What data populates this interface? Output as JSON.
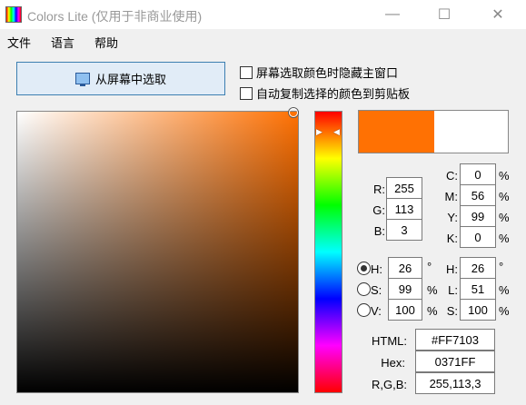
{
  "window": {
    "title": "Colors Lite (仅用于非商业使用)",
    "minimize": "—",
    "maximize": "☐",
    "close": "✕"
  },
  "menu": [
    "文件",
    "语言",
    "帮助"
  ],
  "pick_button": "从屏幕中选取",
  "options": {
    "hide_main": "屏幕选取颜色时隐藏主窗口",
    "auto_copy": "自动复制选择的颜色到剪贴板"
  },
  "colors": {
    "current": "#FF7103",
    "previous": "#FFFFFF"
  },
  "rgb": {
    "r_label": "R:",
    "r": "255",
    "g_label": "G:",
    "g": "113",
    "b_label": "B:",
    "b": "3"
  },
  "cmyk": {
    "c_label": "C:",
    "c": "0",
    "m_label": "M:",
    "m": "56",
    "y_label": "Y:",
    "y": "99",
    "k_label": "K:",
    "k": "0",
    "unit": "%"
  },
  "hsv": {
    "h_label": "H:",
    "h": "26",
    "h_unit": "°",
    "s_label": "S:",
    "s": "99",
    "s_unit": "%",
    "v_label": "V:",
    "v": "100",
    "v_unit": "%",
    "selected": "H"
  },
  "hsl": {
    "h_label": "H:",
    "h": "26",
    "h_unit": "°",
    "l_label": "L:",
    "l": "51",
    "l_unit": "%",
    "s_label": "S:",
    "s": "100",
    "s_unit": "%"
  },
  "codes": {
    "html_label": "HTML:",
    "html": "#FF7103",
    "hex_label": "Hex:",
    "hex": "0371FF",
    "rgb_label": "R,G,B:",
    "rgb": "255,113,3"
  }
}
